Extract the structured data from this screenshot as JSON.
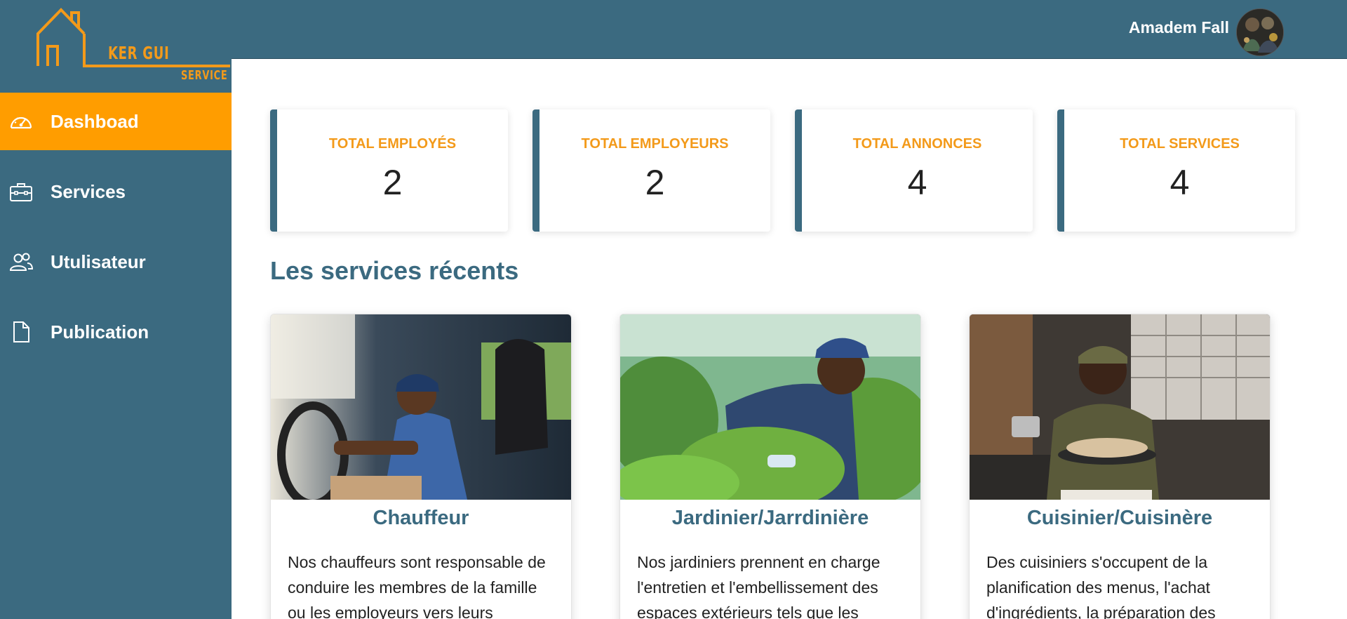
{
  "brand": {
    "name": "KER GUI",
    "subtitle": "SERVICE"
  },
  "sidebar": {
    "items": [
      {
        "label": "Dashboad",
        "icon": "speedometer-icon",
        "active": true
      },
      {
        "label": "Services",
        "icon": "briefcase-icon",
        "active": false
      },
      {
        "label": "Utulisateur",
        "icon": "users-icon",
        "active": false
      },
      {
        "label": "Publication",
        "icon": "document-icon",
        "active": false
      }
    ]
  },
  "header": {
    "user_name": "Amadem Fall"
  },
  "stats": [
    {
      "label": "TOTAL EMPLOYÉS",
      "value": "2"
    },
    {
      "label": "TOTAL EMPLOYEURS",
      "value": "2"
    },
    {
      "label": "TOTAL ANNONCES",
      "value": "4"
    },
    {
      "label": "TOTAL SERVICES",
      "value": "4"
    }
  ],
  "recent": {
    "title": "Les services récents",
    "cards": [
      {
        "title": "Chauffeur",
        "description": "Nos chauffeurs sont responsable de conduire les membres de la famille ou les employeurs vers leurs"
      },
      {
        "title": "Jardinier/Jarrdinière",
        "description": "Nos jardiniers prennent en charge l'entretien et l'embellissement des espaces extérieurs tels que les"
      },
      {
        "title": "Cuisinier/Cuisinère",
        "description": "Des cuisiniers s'occupent de la planification des menus, l'achat d'ingrédients, la préparation des"
      }
    ]
  },
  "colors": {
    "primary": "#3b6a80",
    "accent": "#ff9d00",
    "accent_text": "#f39a1a"
  }
}
